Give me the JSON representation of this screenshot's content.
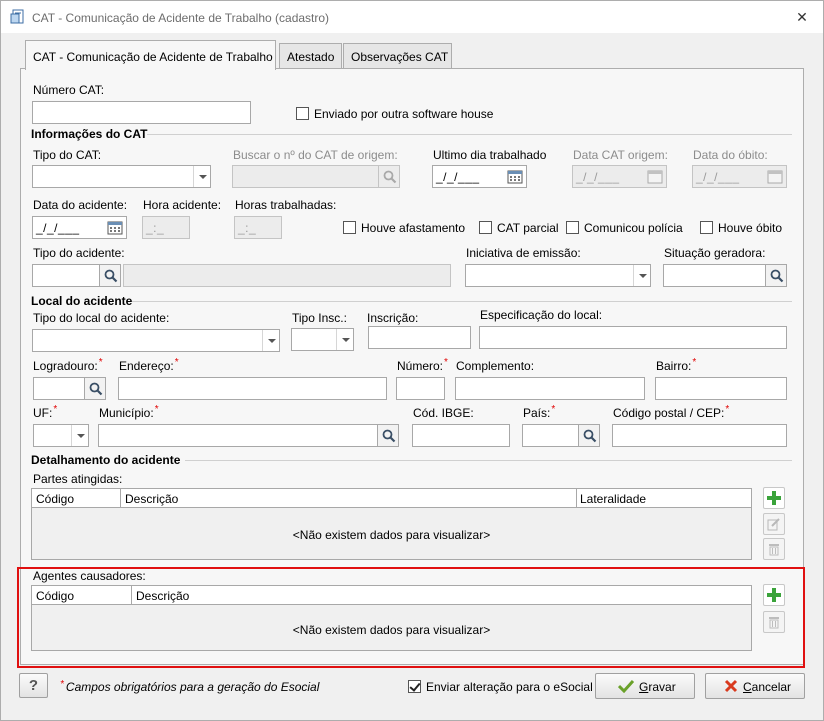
{
  "window": {
    "title": "CAT - Comunicação de Acidente de Trabalho (cadastro)",
    "close_glyph": "✕"
  },
  "tabs": [
    {
      "label": "CAT - Comunicação de Acidente de Trabalho",
      "active": true
    },
    {
      "label": "Atestado",
      "active": false
    },
    {
      "label": "Observações CAT",
      "active": false
    }
  ],
  "form": {
    "numero_cat_label": "Número CAT:",
    "numero_cat_value": "",
    "enviado_outra_label": "Enviado por outra software house",
    "enviado_outra_checked": false,
    "informacoes_section": "Informações do CAT",
    "tipo_cat_label": "Tipo do CAT:",
    "buscar_cat_label": "Buscar o nº do CAT de origem:",
    "ultimo_dia_label": "Ultimo dia trabalhado",
    "ultimo_dia_value": "_/_/___",
    "data_cat_origem_label": "Data CAT origem:",
    "data_cat_origem_value": "_/_/___",
    "data_obito_label": "Data do óbito:",
    "data_obito_value": "_/_/___",
    "data_acidente_label": "Data do acidente:",
    "data_acidente_value": "_/_/___",
    "hora_acidente_label": "Hora acidente:",
    "hora_acidente_value": "_:_",
    "horas_trab_label": "Horas trabalhadas:",
    "horas_trab_value": "_:_",
    "houve_afastamento_label": "Houve afastamento",
    "cat_parcial_label": "CAT parcial",
    "comunicou_policia_label": "Comunicou polícia",
    "houve_obito_label": "Houve óbito",
    "tipo_acidente_label": "Tipo do acidente:",
    "iniciativa_label": "Iniciativa de emissão:",
    "situacao_label": "Situação geradora:",
    "local_section": "Local do acidente",
    "tipo_local_label": "Tipo do local do acidente:",
    "tipo_insc_label": "Tipo Insc.:",
    "inscricao_label": "Inscrição:",
    "especificacao_label": "Especificação do local:",
    "logradouro_label": "Logradouro:",
    "endereco_label": "Endereço:",
    "numero_label": "Número:",
    "complemento_label": "Complemento:",
    "bairro_label": "Bairro:",
    "uf_label": "UF:",
    "municipio_label": "Município:",
    "cod_ibge_label": "Cód. IBGE:",
    "pais_label": "País:",
    "cep_label": "Código postal / CEP:",
    "required_mark": "*",
    "detalhamento_section": "Detalhamento do acidente",
    "partes_label": "Partes atingidas:",
    "partes_columns": [
      "Código",
      "Descrição",
      "Lateralidade"
    ],
    "partes_empty": "<Não existem dados para visualizar>",
    "agentes_label": "Agentes causadores:",
    "agentes_columns": [
      "Código",
      "Descrição"
    ],
    "agentes_empty": "<Não existem dados para visualizar>"
  },
  "footer": {
    "help_label": "?",
    "required_note": "Campos obrigatórios para a geração do Esocial",
    "enviar_alteracao_label": "Enviar alteração para o eSocial",
    "enviar_alteracao_checked": true,
    "gravar_first": "G",
    "gravar_rest": "ravar",
    "cancelar_first": "C",
    "cancelar_rest": "ancelar"
  },
  "colors": {
    "highlight": "#e01010",
    "add_green": "#3aa33a",
    "cancel_red": "#d93a1e"
  }
}
